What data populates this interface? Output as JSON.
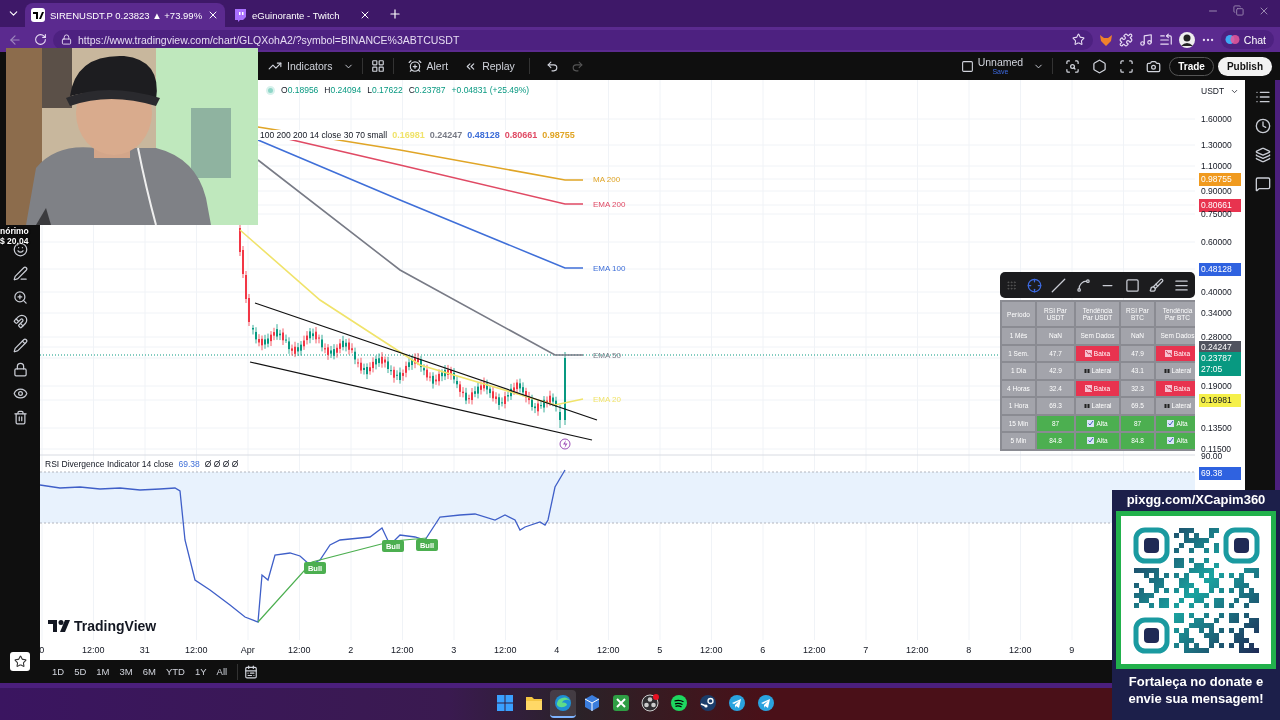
{
  "browser": {
    "tabs": [
      {
        "title": "SIRENUSDT.P 0.23823 ▲ +73.99%",
        "selected": true,
        "kind": "tradingview"
      },
      {
        "title": "eGuinorante - Twitch",
        "selected": false,
        "kind": "twitch"
      }
    ],
    "url": "https://www.tradingview.com/chart/GLQXohA2/?symbol=BINANCE%3ABTCUSDT",
    "chat": "Chat"
  },
  "toolbar": {
    "indicators": "Indicators",
    "alert": "Alert",
    "replay": "Replay",
    "layout": "Unnamed",
    "save": "Save",
    "trade": "Trade",
    "publish": "Publish"
  },
  "side_overlay": [
    "nórimo",
    "$ 20,04"
  ],
  "legend": {
    "ohlc": [
      {
        "label": "O",
        "value": "0.18956"
      },
      {
        "label": "H",
        "value": "0.24094"
      },
      {
        "label": "L",
        "value": "0.17622"
      },
      {
        "label": "C",
        "value": "0.23787"
      }
    ],
    "change": "+0.04831 (+25.49%)"
  },
  "ma_legend": {
    "params": "100 200 200 14 close 30 70 small",
    "values": [
      {
        "text": "0.16981",
        "color": "#f0e36a"
      },
      {
        "text": "0.24247",
        "color": "#787b86"
      },
      {
        "text": "0.48128",
        "color": "#3f6fd8"
      },
      {
        "text": "0.80661",
        "color": "#e04a64"
      },
      {
        "text": "0.98755",
        "color": "#e0a526"
      }
    ]
  },
  "line_labels": [
    {
      "text": "MA 200",
      "color": "#e0a526"
    },
    {
      "text": "EMA 200",
      "color": "#e04a64"
    },
    {
      "text": "EMA 100",
      "color": "#3f6fd8"
    },
    {
      "text": "EMA 50",
      "color": "#787b86"
    },
    {
      "text": "EMA 20",
      "color": "#f0e36a"
    }
  ],
  "price_axis": {
    "currency": "USDT",
    "ticks": [
      {
        "text": "1.60000",
        "kind": "plain"
      },
      {
        "text": "1.30000",
        "kind": "plain"
      },
      {
        "text": "1.10000",
        "kind": "plain"
      },
      {
        "text": "0.98755",
        "kind": "badge",
        "color": "#f09a1e"
      },
      {
        "text": "0.90000",
        "kind": "plain"
      },
      {
        "text": "0.80661",
        "kind": "badge",
        "color": "#e8334f"
      },
      {
        "text": "0.75000",
        "kind": "plain"
      },
      {
        "text": "0.60000",
        "kind": "plain"
      },
      {
        "text": "0.48128",
        "kind": "badge",
        "color": "#2f62e0"
      },
      {
        "text": "0.40000",
        "kind": "plain"
      },
      {
        "text": "0.34000",
        "kind": "plain"
      },
      {
        "text": "0.28000",
        "kind": "plain"
      },
      {
        "text": "0.24247",
        "kind": "badge",
        "color": "#50535e"
      },
      {
        "text": "0.23787",
        "sub": "27:05",
        "kind": "badge",
        "color": "#089981"
      },
      {
        "text": "0.19000",
        "kind": "plain"
      },
      {
        "text": "0.16981",
        "kind": "badge",
        "color": "#f5f04a"
      },
      {
        "text": "0.13500",
        "kind": "plain"
      },
      {
        "text": "0.11500",
        "kind": "plain"
      },
      {
        "text": "90.00",
        "kind": "plain"
      },
      {
        "text": "69.38",
        "kind": "badge",
        "color": "#2f62e0"
      }
    ]
  },
  "rsi": {
    "title": "RSI Divergence Indicator 14 close",
    "value": "69.38",
    "flags": "Ø Ø Ø Ø",
    "signals": [
      "Bull",
      "Bull",
      "Bull"
    ]
  },
  "brand": "TradingView",
  "time_axis": [
    "0",
    "12:00",
    "31",
    "12:00",
    "Apr",
    "12:00",
    "2",
    "12:00",
    "3",
    "12:00",
    "4",
    "12:00",
    "5",
    "12:00",
    "6",
    "12:00",
    "7",
    "12:00",
    "8",
    "12:00",
    "9"
  ],
  "ranges": [
    "1D",
    "5D",
    "1M",
    "3M",
    "6M",
    "YTD",
    "1Y",
    "All"
  ],
  "table": {
    "header": [
      "Período",
      "RSI Par USDT",
      "Tendência Par USDT",
      "RSI Par BTC",
      "Tendência Par BTC"
    ],
    "rows": [
      {
        "cells": [
          {
            "text": "1 Mês",
            "kind": "plain",
            "color": "#a3a4ab"
          },
          {
            "text": "NaN",
            "kind": "plain",
            "color": "#a3a4ab"
          },
          {
            "text": "Sem Dados",
            "kind": "plain",
            "color": "#a3a4ab"
          },
          {
            "text": "NaN",
            "kind": "plain",
            "color": "#a3a4ab"
          },
          {
            "text": "Sem Dados",
            "kind": "plain",
            "color": "#a3a4ab"
          }
        ]
      },
      {
        "cells": [
          {
            "text": "1 Sem.",
            "kind": "plain",
            "color": "#a3a4ab"
          },
          {
            "text": "47.7",
            "kind": "plain",
            "color": "#a3a4ab"
          },
          {
            "text": "Baixa",
            "kind": "down",
            "color": "#e8334f"
          },
          {
            "text": "47.9",
            "kind": "plain",
            "color": "#a3a4ab"
          },
          {
            "text": "Baixa",
            "kind": "down",
            "color": "#e8334f"
          }
        ]
      },
      {
        "cells": [
          {
            "text": "1 Dia",
            "kind": "plain",
            "color": "#a3a4ab"
          },
          {
            "text": "42.9",
            "kind": "plain",
            "color": "#a3a4ab"
          },
          {
            "text": "Lateral",
            "kind": "side",
            "color": "#a3a4ab"
          },
          {
            "text": "43.1",
            "kind": "plain",
            "color": "#a3a4ab"
          },
          {
            "text": "Lateral",
            "kind": "side",
            "color": "#a3a4ab"
          }
        ]
      },
      {
        "cells": [
          {
            "text": "4 Horas",
            "kind": "plain",
            "color": "#a3a4ab"
          },
          {
            "text": "32.4",
            "kind": "plain",
            "color": "#a3a4ab"
          },
          {
            "text": "Baixa",
            "kind": "down",
            "color": "#e8334f"
          },
          {
            "text": "32.3",
            "kind": "plain",
            "color": "#a3a4ab"
          },
          {
            "text": "Baixa",
            "kind": "down",
            "color": "#e8334f"
          }
        ]
      },
      {
        "cells": [
          {
            "text": "1 Hora",
            "kind": "plain",
            "color": "#a3a4ab"
          },
          {
            "text": "69.3",
            "kind": "plain",
            "color": "#a3a4ab"
          },
          {
            "text": "Lateral",
            "kind": "side",
            "color": "#a3a4ab"
          },
          {
            "text": "69.5",
            "kind": "plain",
            "color": "#a3a4ab"
          },
          {
            "text": "Lateral",
            "kind": "side",
            "color": "#a3a4ab"
          }
        ]
      },
      {
        "cells": [
          {
            "text": "15 Min",
            "kind": "plain",
            "color": "#a3a4ab"
          },
          {
            "text": "87",
            "kind": "plain",
            "color": "#4caf50"
          },
          {
            "text": "Alta",
            "kind": "up",
            "color": "#4caf50"
          },
          {
            "text": "87",
            "kind": "plain",
            "color": "#4caf50"
          },
          {
            "text": "Alta",
            "kind": "up",
            "color": "#4caf50"
          }
        ]
      },
      {
        "cells": [
          {
            "text": "5 Min",
            "kind": "plain",
            "color": "#a3a4ab"
          },
          {
            "text": "84.8",
            "kind": "plain",
            "color": "#4caf50"
          },
          {
            "text": "Alta",
            "kind": "up",
            "color": "#4caf50"
          },
          {
            "text": "84.8",
            "kind": "plain",
            "color": "#4caf50"
          },
          {
            "text": "Alta",
            "kind": "up",
            "color": "#4caf50"
          }
        ]
      }
    ]
  },
  "donation": {
    "url": "pixgg.com/XCapim360",
    "message": "Fortaleça no donate e envie sua mensagem!"
  },
  "taskbar": [
    {
      "kind": "start",
      "selected": false
    },
    {
      "kind": "files",
      "selected": false
    },
    {
      "kind": "edge",
      "selected": true
    },
    {
      "kind": "app",
      "selected": false
    },
    {
      "kind": "xbox",
      "selected": false
    },
    {
      "kind": "obs",
      "selected": false
    },
    {
      "kind": "spotify",
      "selected": false
    },
    {
      "kind": "steam",
      "selected": false
    },
    {
      "kind": "telegram",
      "selected": false
    },
    {
      "kind": "telegram",
      "selected": false
    }
  ]
}
